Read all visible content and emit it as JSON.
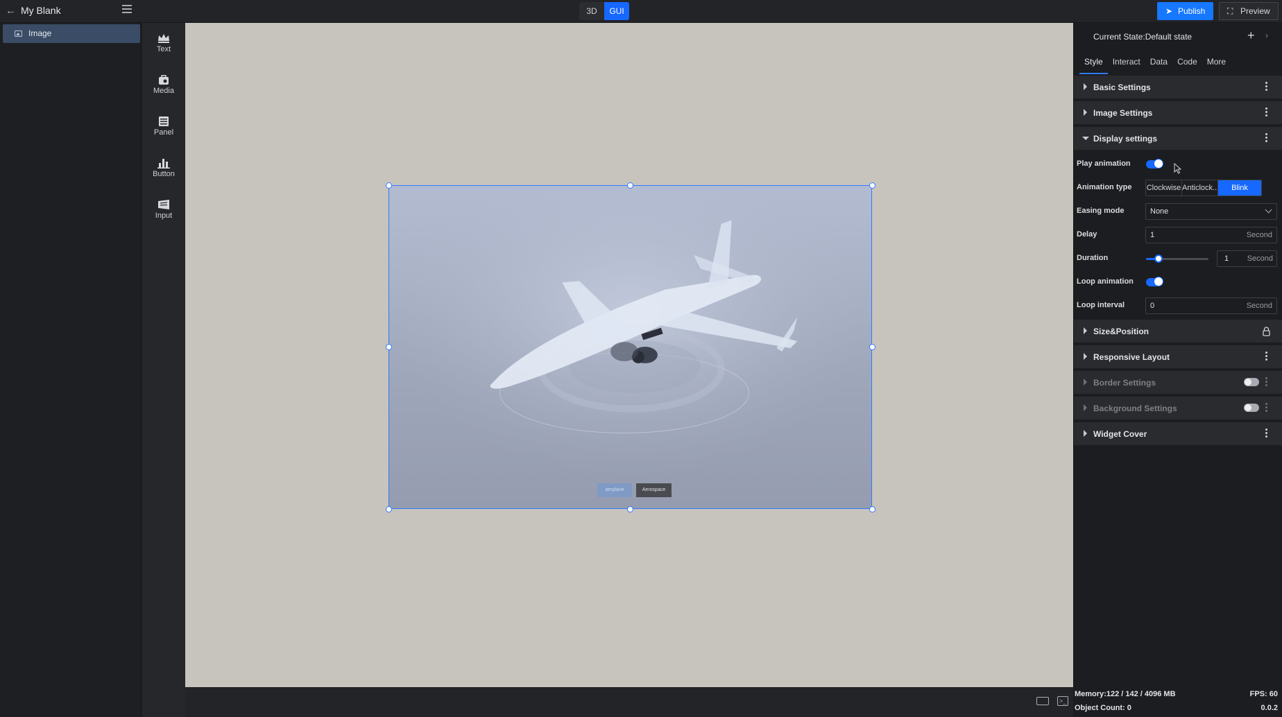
{
  "header": {
    "project_title": "My Blank",
    "mode_3d": "3D",
    "mode_gui": "GUI",
    "publish": "Publish",
    "preview": "Preview"
  },
  "layers": {
    "items": [
      {
        "label": "Image"
      }
    ]
  },
  "widgets": [
    {
      "label": "Text",
      "icon": "crown-icon"
    },
    {
      "label": "Media",
      "icon": "media-bag-icon"
    },
    {
      "label": "Panel",
      "icon": "panel-icon"
    },
    {
      "label": "Button",
      "icon": "bar-chart-icon"
    },
    {
      "label": "Input",
      "icon": "input-icon"
    }
  ],
  "canvas": {
    "image_buttons": [
      "aerplane",
      "Aerospace"
    ]
  },
  "props": {
    "state_title": "Current State:Default state",
    "tabs": [
      "Style",
      "Interact",
      "Data",
      "Code",
      "More"
    ],
    "sections": {
      "basic": "Basic Settings",
      "image": "Image Settings",
      "display": "Display settings",
      "size": "Size&Position",
      "responsive": "Responsive Layout",
      "border": "Border Settings",
      "background": "Background Settings",
      "cover": "Widget Cover"
    },
    "fields": {
      "play_animation": {
        "label": "Play animation",
        "on": true
      },
      "animation_type": {
        "label": "Animation type",
        "options": [
          "Clockwise",
          "Anticlock...",
          "Blink"
        ],
        "selected": "Blink"
      },
      "easing_mode": {
        "label": "Easing mode",
        "value": "None"
      },
      "delay": {
        "label": "Delay",
        "value": "1",
        "unit": "Second"
      },
      "duration": {
        "label": "Duration",
        "value": "1",
        "unit": "Second",
        "level": 0.2
      },
      "loop_animation": {
        "label": "Loop animation",
        "on": true
      },
      "loop_interval": {
        "label": "Loop interval",
        "value": "0",
        "unit": "Second"
      }
    }
  },
  "status": {
    "memory": "Memory:122 / 142 / 4096 MB",
    "fps": "FPS: 60",
    "object_count": "Object Count: 0",
    "version": "0.0.2"
  },
  "colors": {
    "accent": "#1668ff",
    "selection": "#2f7bff",
    "canvas_bg": "#c7c3bd"
  }
}
